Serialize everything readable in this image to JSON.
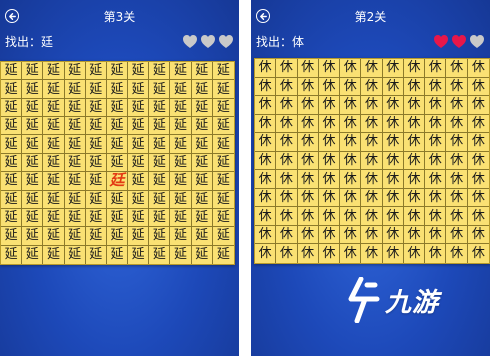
{
  "screens": [
    {
      "title": "第3关",
      "find_label": "找出：廷",
      "common_char": "延",
      "odd_char": "廷",
      "odd_cell": 71,
      "hearts": [
        "empty",
        "empty",
        "empty"
      ],
      "rows": 11,
      "cols": 11
    },
    {
      "title": "第2关",
      "find_label": "找出：体",
      "common_char": "休",
      "hearts": [
        "full",
        "full",
        "empty"
      ],
      "rows": 11,
      "cols": 11
    }
  ],
  "colors": {
    "heart_full": "#e8174a",
    "heart_empty": "#c9c9c9",
    "grid_bg": "#fae173",
    "panel_bg": "#1d49b9",
    "odd_char": "#e33a14"
  },
  "watermark": {
    "text": "九游",
    "icon": "logo-icon"
  }
}
